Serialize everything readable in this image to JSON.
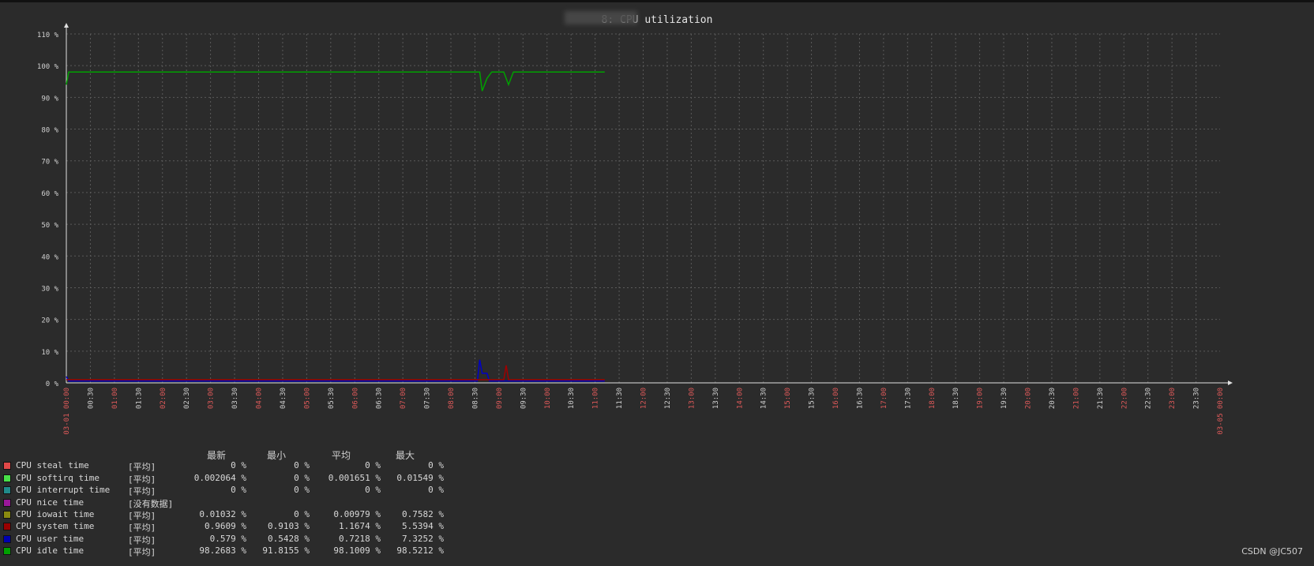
{
  "chart_data": {
    "type": "line",
    "title": "8: CPU utilization",
    "y_ticks": [
      "0 %",
      "10 %",
      "20 %",
      "30 %",
      "40 %",
      "50 %",
      "60 %",
      "70 %",
      "80 %",
      "90 %",
      "100 %",
      "110 %"
    ],
    "ylim": [
      0,
      110
    ],
    "x_ticks": [
      "03-01 00:00",
      "00:30",
      "01:00",
      "01:30",
      "02:00",
      "02:30",
      "03:00",
      "03:30",
      "04:00",
      "04:30",
      "05:00",
      "05:30",
      "06:00",
      "06:30",
      "07:00",
      "07:30",
      "08:00",
      "08:30",
      "09:00",
      "09:30",
      "10:00",
      "10:30",
      "11:00",
      "11:30",
      "12:00",
      "12:30",
      "13:00",
      "13:30",
      "14:00",
      "14:30",
      "15:00",
      "15:30",
      "16:00",
      "16:30",
      "17:00",
      "17:30",
      "18:00",
      "18:30",
      "19:00",
      "19:30",
      "20:00",
      "20:30",
      "21:00",
      "21:30",
      "22:00",
      "22:30",
      "23:00",
      "23:30",
      "03-05 00:00"
    ],
    "x_range_hours": [
      0,
      24
    ],
    "data_end_hour": 11.2,
    "grid": true,
    "series": [
      {
        "name": "CPU idle time",
        "color": "#00a000",
        "x": [
          0,
          0.05,
          0.5,
          1,
          2,
          3,
          4,
          5,
          6,
          7,
          8,
          8.6,
          8.65,
          8.75,
          8.85,
          9.0,
          9.1,
          9.2,
          9.3,
          10,
          11,
          11.2
        ],
        "y": [
          94,
          98,
          98,
          98,
          98,
          98,
          98,
          98,
          98,
          98,
          98,
          98,
          92,
          96,
          98,
          98,
          98,
          94,
          98,
          98,
          98,
          98
        ]
      },
      {
        "name": "CPU user time",
        "color": "#0000c8",
        "x": [
          0,
          0.05,
          1,
          3,
          5,
          7,
          8,
          8.55,
          8.6,
          8.65,
          8.75,
          8.8,
          10,
          11.2
        ],
        "y": [
          2,
          0.6,
          0.6,
          0.6,
          0.6,
          0.6,
          0.6,
          0.6,
          7.3,
          3,
          3,
          0.6,
          0.6,
          0.6
        ]
      },
      {
        "name": "CPU system time",
        "color": "#a00000",
        "x": [
          0,
          1,
          3,
          5,
          7,
          9.1,
          9.15,
          9.2,
          10,
          11.2
        ],
        "y": [
          1,
          1,
          1,
          1,
          1,
          1,
          5.5,
          1,
          1,
          1
        ]
      }
    ],
    "legend": {
      "headers": [
        "最新",
        "最小",
        "平均",
        "最大"
      ],
      "rows": [
        {
          "color": "#e04848",
          "name": "CPU steal time",
          "func": "[平均]",
          "values": [
            "0 %",
            "0 %",
            "0 %",
            "0 %"
          ]
        },
        {
          "color": "#48e048",
          "name": "CPU softirq time",
          "func": "[平均]",
          "values": [
            "0.002064 %",
            "0 %",
            "0.001651 %",
            "0.01549 %"
          ]
        },
        {
          "color": "#208a8a",
          "name": "CPU interrupt time",
          "func": "[平均]",
          "values": [
            "0 %",
            "0 %",
            "0 %",
            "0 %"
          ]
        },
        {
          "color": "#9a189a",
          "name": "CPU nice time",
          "func": "[没有数据]",
          "values": [
            "",
            "",
            "",
            ""
          ]
        },
        {
          "color": "#8a8a10",
          "name": "CPU iowait time",
          "func": "[平均]",
          "values": [
            "0.01032 %",
            "0 %",
            "0.00979 %",
            "0.7582 %"
          ]
        },
        {
          "color": "#9a0000",
          "name": "CPU system time",
          "func": "[平均]",
          "values": [
            "0.9609 %",
            "0.9103 %",
            "1.1674 %",
            "5.5394 %"
          ]
        },
        {
          "color": "#0000b0",
          "name": "CPU user time",
          "func": "[平均]",
          "values": [
            "0.579 %",
            "0.5428 %",
            "0.7218 %",
            "7.3252 %"
          ]
        },
        {
          "color": "#00a000",
          "name": "CPU idle time",
          "func": "[平均]",
          "values": [
            "98.2683 %",
            "91.8155 %",
            "98.1009 %",
            "98.5212 %"
          ]
        }
      ]
    }
  },
  "watermark": "CSDN @JC507"
}
